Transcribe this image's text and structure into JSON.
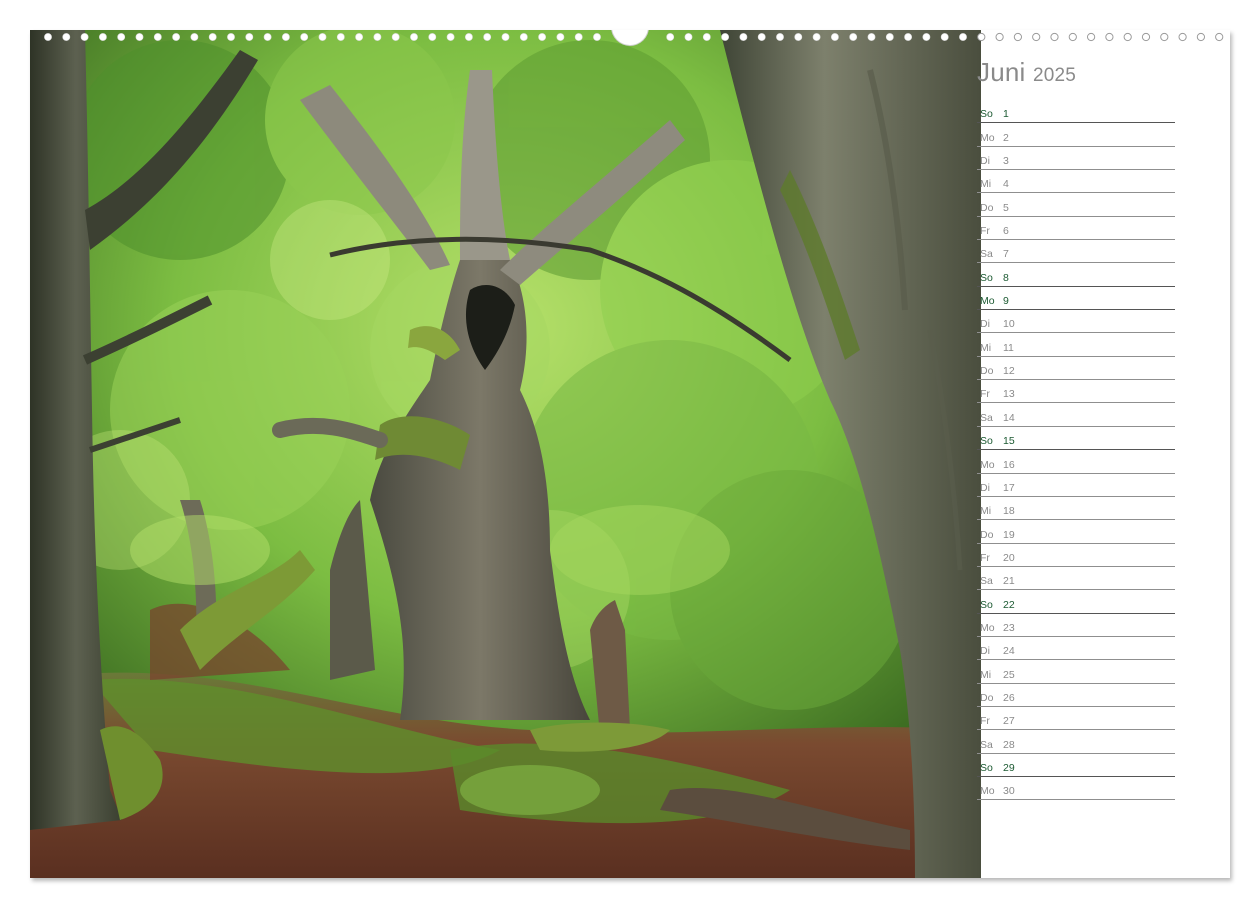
{
  "calendar": {
    "month": "Juni",
    "year": "2025",
    "accent_color": "#1c5a32",
    "text_color": "#8a8a8a",
    "days": [
      {
        "name": "So",
        "num": "1",
        "type": "sun"
      },
      {
        "name": "Mo",
        "num": "2",
        "type": "normal"
      },
      {
        "name": "Di",
        "num": "3",
        "type": "normal"
      },
      {
        "name": "Mi",
        "num": "4",
        "type": "normal"
      },
      {
        "name": "Do",
        "num": "5",
        "type": "normal"
      },
      {
        "name": "Fr",
        "num": "6",
        "type": "normal"
      },
      {
        "name": "Sa",
        "num": "7",
        "type": "normal"
      },
      {
        "name": "So",
        "num": "8",
        "type": "sun"
      },
      {
        "name": "Mo",
        "num": "9",
        "type": "hol"
      },
      {
        "name": "Di",
        "num": "10",
        "type": "normal"
      },
      {
        "name": "Mi",
        "num": "11",
        "type": "normal"
      },
      {
        "name": "Do",
        "num": "12",
        "type": "normal"
      },
      {
        "name": "Fr",
        "num": "13",
        "type": "normal"
      },
      {
        "name": "Sa",
        "num": "14",
        "type": "normal"
      },
      {
        "name": "So",
        "num": "15",
        "type": "sun"
      },
      {
        "name": "Mo",
        "num": "16",
        "type": "normal"
      },
      {
        "name": "Di",
        "num": "17",
        "type": "normal"
      },
      {
        "name": "Mi",
        "num": "18",
        "type": "normal"
      },
      {
        "name": "Do",
        "num": "19",
        "type": "normal"
      },
      {
        "name": "Fr",
        "num": "20",
        "type": "normal"
      },
      {
        "name": "Sa",
        "num": "21",
        "type": "normal"
      },
      {
        "name": "So",
        "num": "22",
        "type": "sun"
      },
      {
        "name": "Mo",
        "num": "23",
        "type": "normal"
      },
      {
        "name": "Di",
        "num": "24",
        "type": "normal"
      },
      {
        "name": "Mi",
        "num": "25",
        "type": "normal"
      },
      {
        "name": "Do",
        "num": "26",
        "type": "normal"
      },
      {
        "name": "Fr",
        "num": "27",
        "type": "normal"
      },
      {
        "name": "Sa",
        "num": "28",
        "type": "normal"
      },
      {
        "name": "So",
        "num": "29",
        "type": "sun"
      },
      {
        "name": "Mo",
        "num": "30",
        "type": "normal"
      }
    ]
  },
  "photo": {
    "subject": "forest-photo",
    "palette": {
      "canopy": "#6fae3a",
      "canopy_light": "#a9d65a",
      "canopy_dark": "#2f5b1c",
      "bark": "#5a5a4e",
      "bark_light": "#8c8a78",
      "moss": "#7a9a34",
      "forest_floor": "#6b3d2a"
    }
  }
}
